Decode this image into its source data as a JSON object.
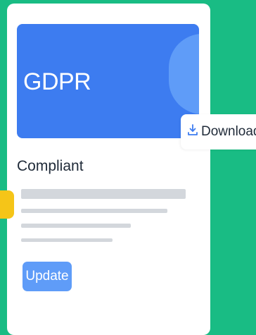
{
  "banner": {
    "title": "GDPR"
  },
  "download": {
    "label": "Download",
    "icon": "download-icon"
  },
  "status": {
    "text": "Compliant"
  },
  "actions": {
    "update_label": "Update"
  },
  "colors": {
    "background": "#19bc84",
    "banner": "#3d7cf0",
    "banner_accent": "#5f9cf8",
    "button": "#5f9cf8",
    "marker": "#f5c518",
    "skeleton": "#d3d7dc"
  }
}
